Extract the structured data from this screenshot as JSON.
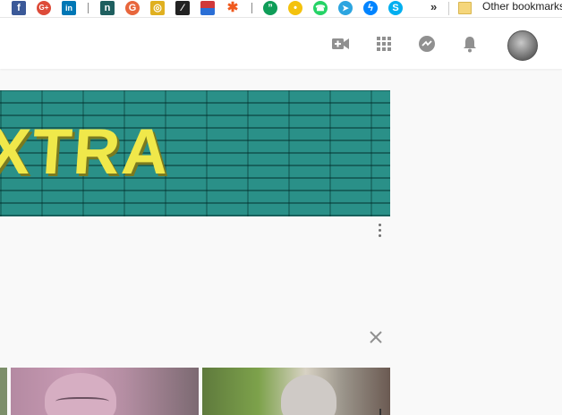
{
  "bookmarks_bar": {
    "items": [
      {
        "icon": "facebook-icon",
        "glyph": "f",
        "color": "#3b5998"
      },
      {
        "icon": "google-plus-icon",
        "glyph": "G+",
        "color": "#dd4b39"
      },
      {
        "icon": "linkedin-icon",
        "glyph": "in",
        "color": "#0077b5"
      },
      {
        "icon": "n-icon",
        "glyph": "n",
        "color": "#1f5f5f"
      },
      {
        "icon": "grammarly-icon",
        "glyph": "G",
        "color": "#e8663c"
      },
      {
        "icon": "yellow-circle-icon",
        "glyph": "◎",
        "color": "#e0b020"
      },
      {
        "icon": "black-slash-icon",
        "glyph": "⁄",
        "color": "#222222"
      },
      {
        "icon": "red-blue-square-icon",
        "glyph": "",
        "color": "#d0383a"
      },
      {
        "icon": "orange-gear-icon",
        "glyph": "✱",
        "color": "#f05a1e"
      },
      {
        "icon": "hangouts-icon",
        "glyph": "”",
        "color": "#0f9d58"
      },
      {
        "icon": "yellow-chat-icon",
        "glyph": "•",
        "color": "#f4c20d"
      },
      {
        "icon": "whatsapp-icon",
        "glyph": "☎",
        "color": "#25d366"
      },
      {
        "icon": "telegram-icon",
        "glyph": "➤",
        "color": "#2ca5e0"
      },
      {
        "icon": "messenger-icon",
        "glyph": "ϟ",
        "color": "#0084ff"
      },
      {
        "icon": "skype-icon",
        "glyph": "S",
        "color": "#00aff0"
      }
    ],
    "more_label": "»",
    "other_bookmarks_label": "Other bookmarks"
  },
  "header": {
    "icons": [
      "create-video-icon",
      "apps-grid-icon",
      "messages-icon",
      "notifications-bell-icon"
    ],
    "icon_color": "#909090"
  },
  "banner": {
    "text": "XTRA",
    "background_color": "#2a9088",
    "text_color": "#f0e84a"
  }
}
